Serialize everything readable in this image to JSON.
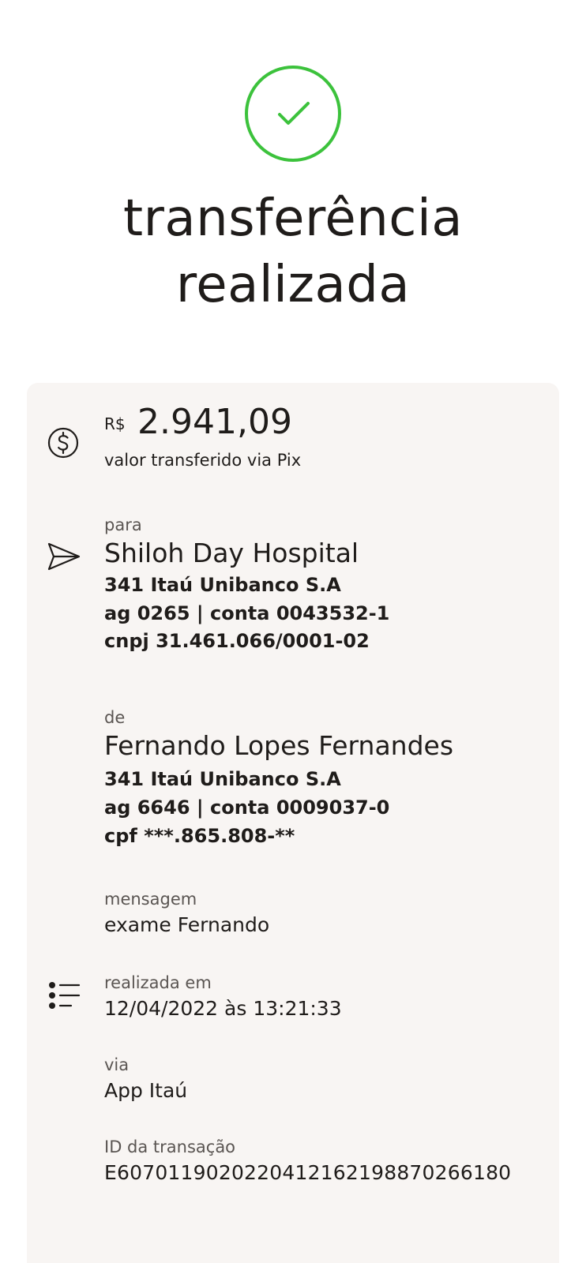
{
  "header": {
    "status_icon": "check-circle-icon",
    "title_line1": "transferência",
    "title_line2": "realizada"
  },
  "amount": {
    "currency": "R$",
    "value": "2.941,09",
    "caption": "valor transferido via Pix",
    "icon": "dollar-circle-icon"
  },
  "recipient": {
    "label": "para",
    "name": "Shiloh Day Hospital",
    "bank": "341 Itaú Unibanco S.A",
    "account": "ag 0265 | conta 0043532-1",
    "document": "cnpj 31.461.066/0001-02",
    "icon": "send-icon"
  },
  "sender": {
    "label": "de",
    "name": "Fernando Lopes Fernandes",
    "bank": "341 Itaú Unibanco S.A",
    "account": "ag 6646 | conta 0009037-0",
    "document": "cpf ***.865.808-**"
  },
  "message": {
    "label": "mensagem",
    "value": "exame Fernando"
  },
  "details": {
    "icon": "list-icon",
    "date_label": "realizada em",
    "date_value": "12/04/2022 às 13:21:33",
    "channel_label": "via",
    "channel_value": "App Itaú",
    "id_label": "ID da transação",
    "id_value": "E60701190202204121621988702661​80"
  },
  "colors": {
    "success": "#3cc23c",
    "card_background": "#f8f5f3",
    "text": "#1f1c1a"
  }
}
